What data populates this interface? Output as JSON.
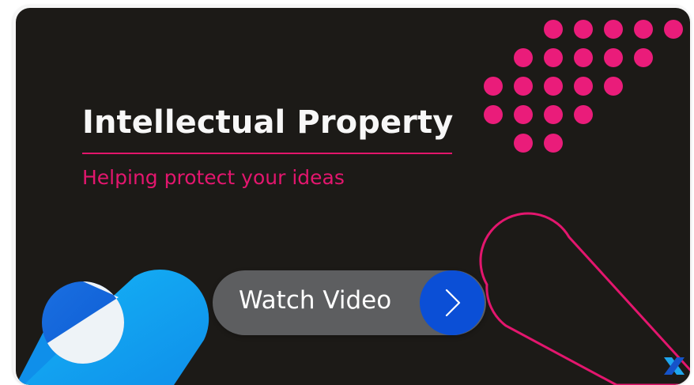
{
  "thumbnail": {
    "title": "Intellectual Property",
    "subtitle": "Helping protect your ideas",
    "colors": {
      "background": "#1c1a17",
      "accent_pink": "#e3166e",
      "accent_blue": "#10a9f0",
      "button_grey": "#5d5e60",
      "button_blue": "#0b4fd6"
    },
    "watch_button": {
      "label": "Watch Video",
      "icon": "chevron-right-icon"
    },
    "decorations": {
      "dot_grid": "pink-dot-grid",
      "ring": "pink-outline-ring",
      "capsule": "blue-capsule-shape",
      "logo": "brand-x-logo-icon"
    }
  }
}
